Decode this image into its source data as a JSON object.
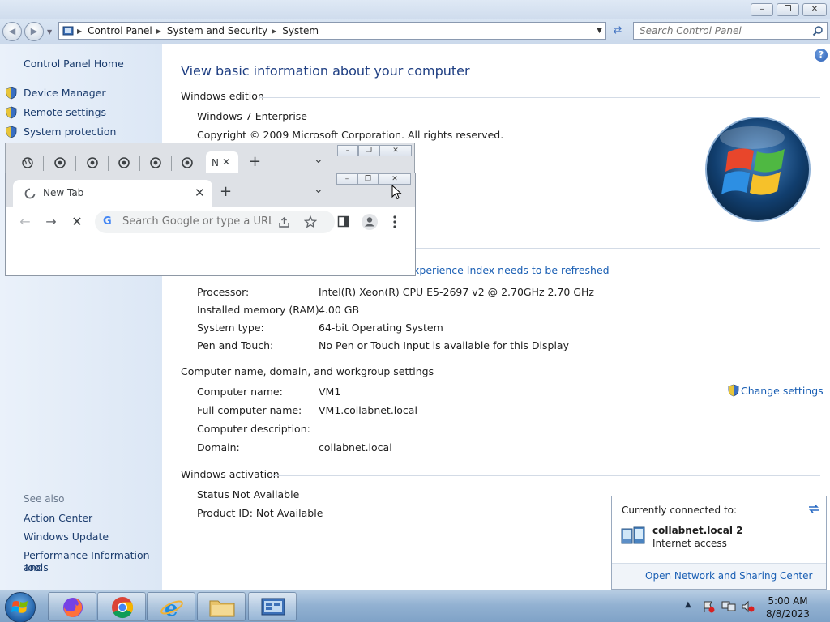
{
  "window": {
    "minimize": "–",
    "maximize": "❐",
    "close": "✕"
  },
  "address": {
    "crumbs": [
      "Control Panel",
      "System and Security",
      "System"
    ],
    "search_placeholder": "Search Control Panel"
  },
  "sidebar": {
    "home": "Control Panel Home",
    "tasks": [
      {
        "label": "Device Manager"
      },
      {
        "label": "Remote settings"
      },
      {
        "label": "System protection"
      }
    ],
    "see_also_title": "See also",
    "see_also": [
      {
        "label": "Action Center"
      },
      {
        "label": "Windows Update"
      },
      {
        "label": "Performance Information and"
      },
      {
        "label": "Tools"
      }
    ]
  },
  "main": {
    "title": "View basic information about your computer",
    "edition": {
      "heading": "Windows edition",
      "name": "Windows 7 Enterprise",
      "copyright": "Copyright © 2009 Microsoft Corporation.  All rights reserved."
    },
    "system": {
      "rating_link": "xperience Index needs to be refreshed",
      "rows": [
        {
          "label": "Processor:",
          "value": "Intel(R) Xeon(R) CPU E5-2697 v2 @ 2.70GHz   2.70 GHz"
        },
        {
          "label": "Installed memory (RAM):",
          "value": "4.00 GB"
        },
        {
          "label": "System type:",
          "value": "64-bit Operating System"
        },
        {
          "label": "Pen and Touch:",
          "value": "No Pen or Touch Input is available for this Display"
        }
      ]
    },
    "computer": {
      "heading": "Computer name, domain, and workgroup settings",
      "change_settings": "Change settings",
      "rows": [
        {
          "label": "Computer name:",
          "value": "VM1"
        },
        {
          "label": "Full computer name:",
          "value": "VM1.collabnet.local"
        },
        {
          "label": "Computer description:",
          "value": ""
        },
        {
          "label": "Domain:",
          "value": "collabnet.local"
        }
      ]
    },
    "activation": {
      "heading": "Windows activation",
      "status": "Status Not Available",
      "product_id": "Product ID:  Not Available"
    }
  },
  "chrome": {
    "back_tab_partial": "N",
    "tab_title": "New Tab",
    "tab_close": "✕",
    "new_tab": "+",
    "tab_search": "⌄",
    "omnibox_placeholder": "Search Google or type a URL",
    "google_g": "G",
    "nav": {
      "back": "←",
      "forward": "→",
      "stop": "✕"
    }
  },
  "network_popup": {
    "header": "Currently connected to:",
    "network_name": "collabnet.local  2",
    "access": "Internet access",
    "footer_link": "Open Network and Sharing Center"
  },
  "taskbar": {
    "apps": [
      "windows-start",
      "firefox",
      "chrome",
      "internet-explorer",
      "file-explorer",
      "control-panel"
    ],
    "time": "5:00 AM",
    "date": "8/8/2023"
  },
  "colors": {
    "link": "#1a5fb4",
    "title": "#1e3e82",
    "sidebar_bg": "#dce7f5",
    "taskbar": "#93b2d2"
  }
}
